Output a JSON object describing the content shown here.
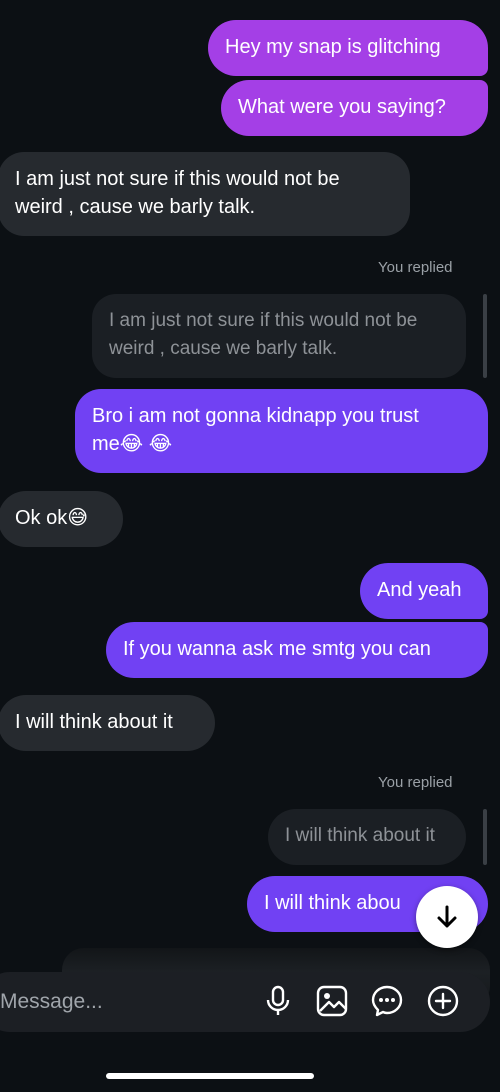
{
  "messages": [
    {
      "text": "Hey my snap is glitching"
    },
    {
      "text": "What were you saying?"
    },
    {
      "line1": "I am just not sure if this would not be",
      "line2": "weird , cause we barly talk."
    },
    {
      "meta": "You replied",
      "quoted_line1": "I am just not sure if this would not be",
      "quoted_line2": "weird , cause we barly talk.",
      "line1": "Bro i am not gonna kidnapp you trust",
      "line2": "me",
      "emoji": "😂 😂"
    },
    {
      "text": "Ok ok",
      "emoji": "😅"
    },
    {
      "text": "And yeah"
    },
    {
      "text": "If you wanna ask me smtg you can"
    },
    {
      "text": "I will think about it"
    },
    {
      "meta": "You replied",
      "quoted": "I will think about it",
      "text": "I will think abou"
    }
  ],
  "composer": {
    "placeholder": "Message...",
    "icons": [
      "microphone-icon",
      "image-icon",
      "sticker-icon",
      "plus-icon"
    ]
  },
  "colors": {
    "background": "#0c1014",
    "incoming": "#262a2f",
    "outgoing_pink": "#a43fe6",
    "outgoing_purple": "#7141f3"
  }
}
